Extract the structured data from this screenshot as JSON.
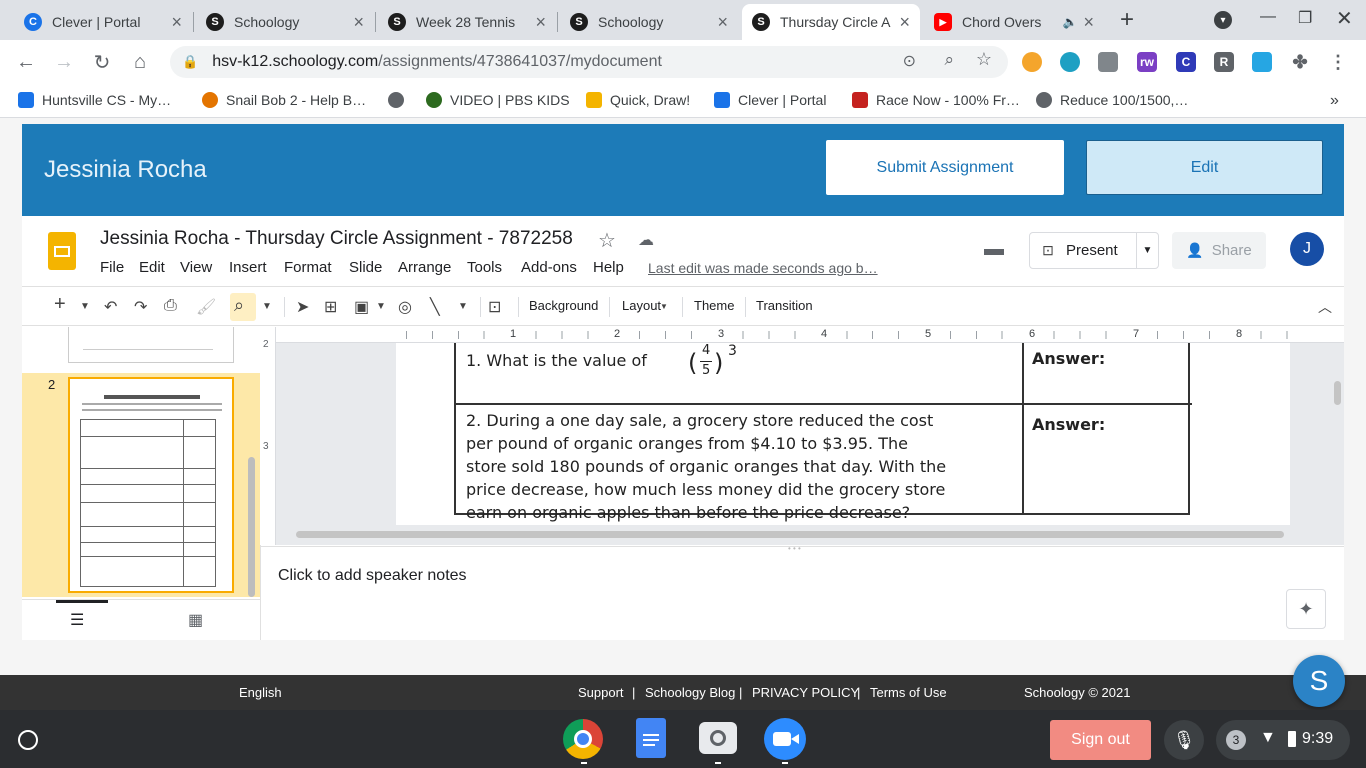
{
  "browser": {
    "tabs": [
      {
        "title": "Clever | Portal",
        "icon": "C",
        "icon_color": "#1a73e8"
      },
      {
        "title": "Schoology",
        "icon": "S",
        "icon_color": "#1d1d1d"
      },
      {
        "title": "Week 28 Tennis",
        "icon": "S",
        "icon_color": "#1d1d1d"
      },
      {
        "title": "Schoology",
        "icon": "S",
        "icon_color": "#1d1d1d"
      },
      {
        "title": "Thursday Circle A",
        "icon": "S",
        "icon_color": "#1d1d1d"
      },
      {
        "title": "Chord Overs",
        "icon": "▶",
        "icon_color": "#ff0000"
      }
    ],
    "url_host": "hsv-k12.schoology.com",
    "url_path": "/assignments/4738641037/mydocument",
    "bookmarks": [
      {
        "label": "Huntsville CS - My…",
        "color": "#1a73e8"
      },
      {
        "label": "Snail Bob 2 - Help B…",
        "color": "#e37400"
      },
      {
        "label": "",
        "color": "#5f6368"
      },
      {
        "label": "VIDEO | PBS KIDS",
        "color": "#2d6a1f"
      },
      {
        "label": "Quick, Draw!",
        "color": "#f4b400"
      },
      {
        "label": "Clever | Portal",
        "color": "#1a73e8"
      },
      {
        "label": "Race Now - 100% Fr…",
        "color": "#c5221f"
      },
      {
        "label": "Reduce 100/1500,…",
        "color": "#5f6368"
      }
    ]
  },
  "schoology": {
    "student_name": "Jessinia Rocha",
    "submit_label": "Submit Assignment",
    "edit_label": "Edit"
  },
  "slides": {
    "doc_title": "Jessinia Rocha - Thursday Circle Assignment - 7872258",
    "menus": [
      "File",
      "Edit",
      "View",
      "Insert",
      "Format",
      "Slide",
      "Arrange",
      "Tools",
      "Add-ons",
      "Help"
    ],
    "last_edit": "Last edit was made seconds ago b…",
    "present_label": "Present",
    "share_label": "Share",
    "avatar_letter": "J",
    "toolbar": {
      "background": "Background",
      "layout": "Layout",
      "theme": "Theme",
      "transition": "Transition"
    },
    "slide_number": "2",
    "ruler_numbers": [
      "1",
      "2",
      "3",
      "4",
      "5",
      "6",
      "7",
      "8"
    ],
    "v_ruler": [
      "2",
      "3"
    ],
    "q1": {
      "text": "1.  What is the value of",
      "num": "4",
      "den": "5",
      "exp": "3",
      "answer": "Answer:"
    },
    "q2": {
      "line1": "2. During a one day sale, a grocery store reduced the cost",
      "line2": "per pound of organic oranges from $4.10 to $3.95. The",
      "line3": "store sold 180 pounds of organic oranges that day. With the",
      "line4": "price decrease, how much less money did the grocery store",
      "line5": "earn on organic apples than before the price decrease?",
      "answer": "Answer:"
    },
    "notes_placeholder": "Click to add speaker notes"
  },
  "footer": {
    "language": "English",
    "support": "Support",
    "blog": "Schoology Blog",
    "privacy": "PRIVACY POLICY",
    "terms": "Terms of Use",
    "copyright": "Schoology © 2021",
    "sep": "|",
    "fab_letter": "S"
  },
  "shelf": {
    "sign_out": "Sign out",
    "notif_count": "3",
    "time": "9:39"
  }
}
